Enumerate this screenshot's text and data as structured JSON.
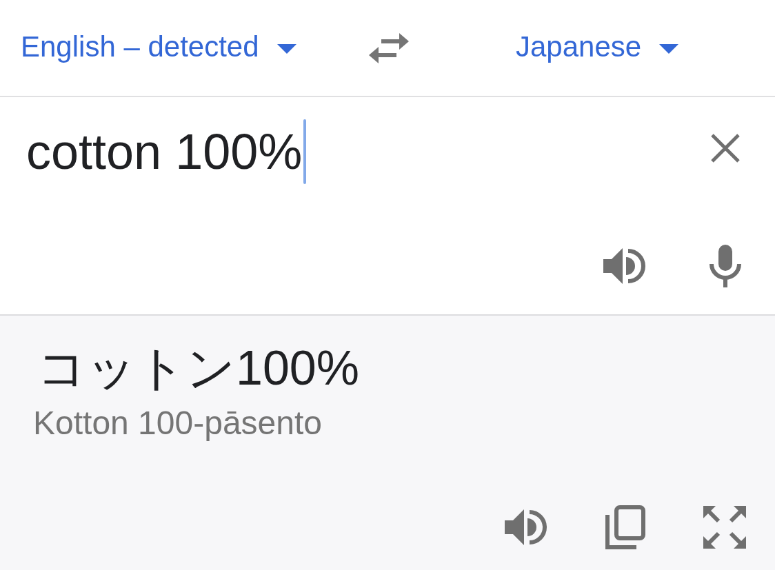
{
  "language_bar": {
    "source_language": "English – detected",
    "target_language": "Japanese"
  },
  "input": {
    "text": "cotton 100%",
    "focused": true
  },
  "result": {
    "translation": "コットン100%",
    "transliteration": "Kotton 100-pāsento"
  }
}
